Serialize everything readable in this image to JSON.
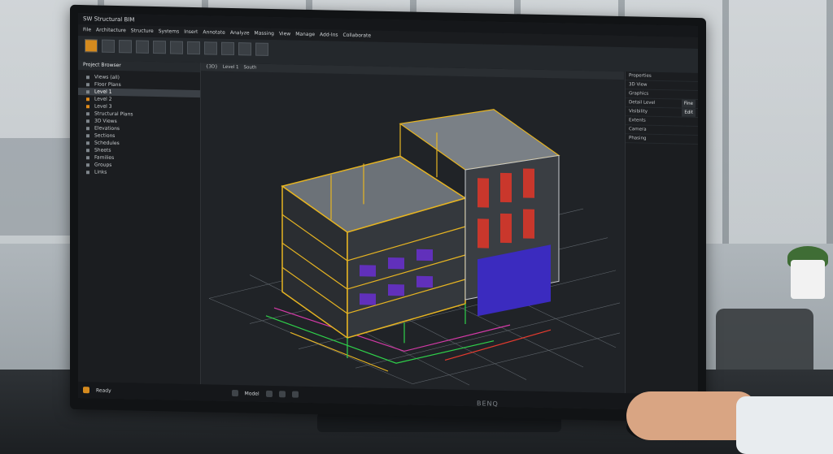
{
  "app": {
    "title": "SW Structural BIM"
  },
  "menu": [
    "File",
    "Architecture",
    "Structure",
    "Systems",
    "Insert",
    "Annotate",
    "Analyze",
    "Massing",
    "View",
    "Manage",
    "Add-Ins",
    "Collaborate"
  ],
  "left_panel": {
    "header": "Project Browser",
    "items": [
      {
        "label": "Views (all)"
      },
      {
        "label": "Floor Plans"
      },
      {
        "label": "Level 1"
      },
      {
        "label": "Level 2"
      },
      {
        "label": "Level 3"
      },
      {
        "label": "Structural Plans"
      },
      {
        "label": "3D Views"
      },
      {
        "label": "Elevations"
      },
      {
        "label": "Sections"
      },
      {
        "label": "Schedules"
      },
      {
        "label": "Sheets"
      },
      {
        "label": "Families"
      },
      {
        "label": "Groups"
      },
      {
        "label": "Links"
      }
    ]
  },
  "viewport": {
    "tabs": [
      "{3D}",
      "Level 1",
      "South"
    ]
  },
  "right_panel": {
    "rows": [
      {
        "label": "Properties",
        "value": ""
      },
      {
        "label": "3D View",
        "value": ""
      },
      {
        "label": "Graphics",
        "value": ""
      },
      {
        "label": "Detail Level",
        "value": "Fine"
      },
      {
        "label": "Visibility",
        "value": "Edit"
      },
      {
        "label": "Extents",
        "value": ""
      },
      {
        "label": "Camera",
        "value": ""
      },
      {
        "label": "Phasing",
        "value": ""
      }
    ]
  },
  "status": {
    "left_text": "Ready",
    "mid_text": "Model"
  },
  "monitor": {
    "brand": "BENQ"
  },
  "colors": {
    "bg": "#1f2226",
    "accent_orange": "#e08a1a",
    "building_yellow": "#e6b422",
    "panel_red": "#c9372c",
    "panel_blue": "#3b2bbf",
    "grid": "#8f98a0"
  }
}
